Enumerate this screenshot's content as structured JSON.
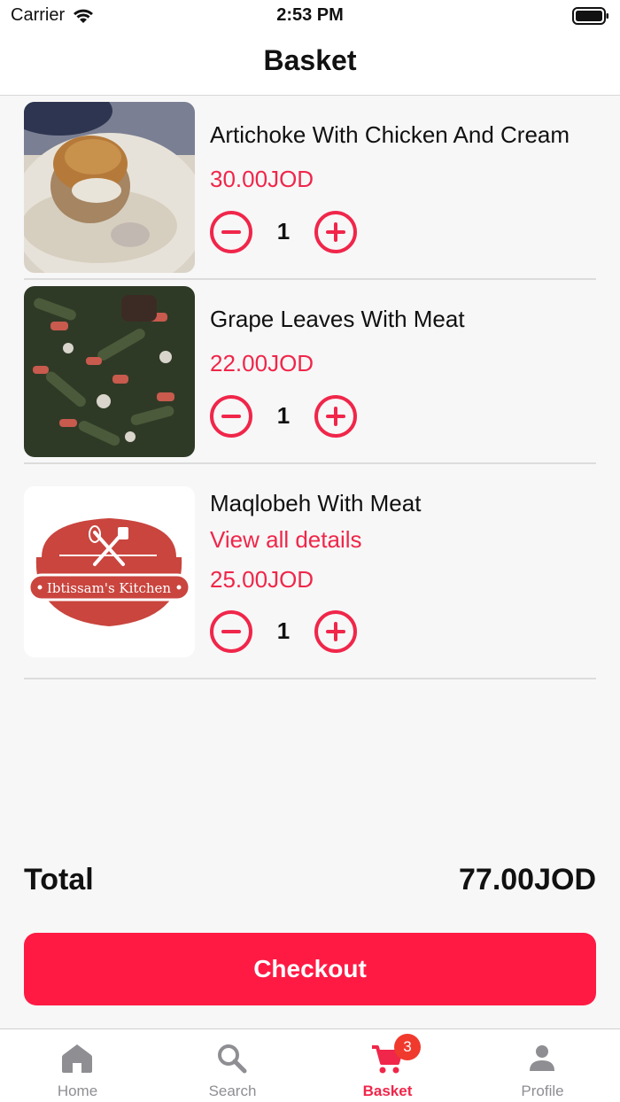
{
  "status_bar": {
    "carrier": "Carrier",
    "time": "2:53 PM"
  },
  "header": {
    "title": "Basket"
  },
  "colors": {
    "accent": "#f0264a",
    "checkout_button": "#ff1a44",
    "badge": "#f03a2e",
    "inactive_tab": "#8e8e93"
  },
  "basket": {
    "items": [
      {
        "name": "Artichoke With Chicken And Cream",
        "price": "30.00JOD",
        "quantity": "1",
        "image": "artichoke-dish-photo"
      },
      {
        "name": "Grape Leaves With Meat",
        "price": "22.00JOD",
        "quantity": "1",
        "image": "grape-leaves-dish-photo"
      },
      {
        "name": "Maqlobeh With Meat",
        "details_link": "View all details",
        "price": "25.00JOD",
        "quantity": "1",
        "image": "kitchen-logo"
      }
    ]
  },
  "logo": {
    "text": "Ibtissam's Kitchen"
  },
  "summary": {
    "total_label": "Total",
    "total_value": "77.00JOD"
  },
  "checkout": {
    "label": "Checkout"
  },
  "tab_bar": {
    "tabs": [
      {
        "label": "Home",
        "icon": "home-icon"
      },
      {
        "label": "Search",
        "icon": "search-icon"
      },
      {
        "label": "Basket",
        "icon": "cart-icon",
        "badge": "3",
        "active": true
      },
      {
        "label": "Profile",
        "icon": "person-icon"
      }
    ]
  }
}
